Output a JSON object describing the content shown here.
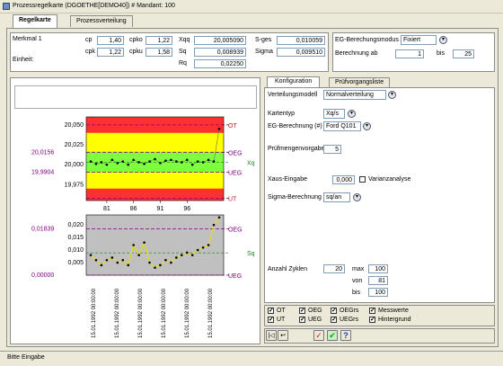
{
  "window": {
    "title": "Prozessregelkarte (DGOETHE[DEMO40]) # Mandant: 100"
  },
  "tabs": [
    {
      "label": "Regelkarte"
    },
    {
      "label": "Prozessverteilung"
    }
  ],
  "header": {
    "merkmal": "Merkmal 1",
    "einheit": "Einheit:",
    "cp_label": "cp",
    "cp": "1,40",
    "cpk_label": "cpk",
    "cpk": "1,22",
    "cpko_label": "cpko",
    "cpko": "1,22",
    "cpku_label": "cpku",
    "cpku": "1,58",
    "xqq_label": "Xqq",
    "xqq": "20,005090",
    "sq_label": "Sq",
    "sq": "0,008939",
    "rq_label": "Rq",
    "rq": "0,02250",
    "sges_label": "S-ges",
    "sges": "0,010059",
    "sigma_label": "Sigma",
    "sigma": "0,009510",
    "eg_modus_label": "EG-Berechungsmodus",
    "eg_modus": "Fixiert",
    "berechnung_ab_label": "Berechnung ab",
    "berechnung_ab": "1",
    "bis_label": "bis",
    "bis": "25"
  },
  "chart_data": [
    {
      "type": "line",
      "title": "",
      "ytick_labels": [
        "20,050",
        "20,025",
        "20,000",
        "19,975"
      ],
      "xtick_labels": [
        "81",
        "86",
        "91",
        "96"
      ],
      "y_marks": {
        "oeg": "20,0156",
        "ueg": "19,9904"
      },
      "zone_labels": {
        "ot": "OT",
        "oeg": "OEG",
        "xq": "Xq",
        "ueg": "UEG",
        "ut": "UT"
      },
      "ylim": [
        19.955,
        20.06
      ],
      "x": [
        78,
        79,
        80,
        81,
        82,
        83,
        84,
        85,
        86,
        87,
        88,
        89,
        90,
        91,
        92,
        93,
        94,
        95,
        96,
        97,
        98,
        99,
        100,
        101,
        102
      ],
      "series": [
        {
          "values": [
            20.004,
            20.001,
            20.003,
            20.0,
            20.006,
            20.002,
            20.004,
            20.0,
            20.006,
            20.003,
            20.001,
            20.004,
            20.007,
            20.002,
            20.005,
            20.006,
            20.004,
            20.003,
            20.006,
            20.0,
            20.004,
            20.003,
            20.006,
            20.004,
            20.045
          ]
        }
      ]
    },
    {
      "type": "line",
      "title": "",
      "ytick_labels": [
        "0,020",
        "0,015",
        "0,010",
        "0,005"
      ],
      "y_marks": {
        "oeg": "0,01839",
        "ueg": "0,00000"
      },
      "zone_labels": {
        "oeg": "OEG",
        "sq": "Sq",
        "ueg": "UEG"
      },
      "ylim": [
        0.0,
        0.024
      ],
      "x": [
        78,
        79,
        80,
        81,
        82,
        83,
        84,
        85,
        86,
        87,
        88,
        89,
        90,
        91,
        92,
        93,
        94,
        95,
        96,
        97,
        98,
        99,
        100,
        101,
        102
      ],
      "series": [
        {
          "values": [
            0.008,
            0.006,
            0.004,
            0.006,
            0.007,
            0.005,
            0.006,
            0.004,
            0.012,
            0.008,
            0.013,
            0.005,
            0.003,
            0.004,
            0.006,
            0.005,
            0.007,
            0.008,
            0.009,
            0.008,
            0.01,
            0.011,
            0.012,
            0.02,
            0.023
          ]
        }
      ],
      "date_labels": [
        "15.01.1992 00:00:00",
        "15.01.1992 00:00:00",
        "15.01.1992 00:00:00",
        "15.01.1992 00:00:00",
        "15.01.1992 00:00:00",
        "15.01.1992 00:00:00"
      ]
    }
  ],
  "right_tabs": [
    {
      "label": "Konfiguration"
    },
    {
      "label": "Prüfvorgangsliste"
    }
  ],
  "config": {
    "verteilungsmodell_label": "Verteilungsmodell",
    "verteilungsmodell": "Normalverteilung",
    "kartentyp_label": "Kartentyp",
    "kartentyp": "Xq/s",
    "eg_berechnung_label": "EG-Berechnung (#)",
    "eg_berechnung": "Ford Q101",
    "pruefmengen_label": "Prüfmengenvorgabe",
    "pruefmengen": "5",
    "xaus_label": "Xaus-Eingabe",
    "xaus": "0,000",
    "varianz_label": "Varianzanalyse",
    "sigma_label": "Sigma-Berechnung",
    "sigma": "sq/an",
    "anzahl_label": "Anzahl Zyklen",
    "anzahl": "20",
    "max_label": "max",
    "max": "100",
    "von_label": "von",
    "von": "81",
    "bis_label": "bis",
    "bis": "100"
  },
  "checks": [
    {
      "label": "OT"
    },
    {
      "label": "OEG"
    },
    {
      "label": "OEGrs"
    },
    {
      "label": "Messwerte"
    },
    {
      "label": "UT"
    },
    {
      "label": "UEG"
    },
    {
      "label": "UEGrs"
    },
    {
      "label": "Hintergrund"
    }
  ],
  "status": {
    "text": "Bitte Eingabe"
  },
  "colors": {
    "red": "#ff3030",
    "yellow": "#ffff00",
    "green": "#80ff40",
    "gray": "#c0c0c0",
    "purple": "#800080",
    "limit": "#ff2080"
  }
}
